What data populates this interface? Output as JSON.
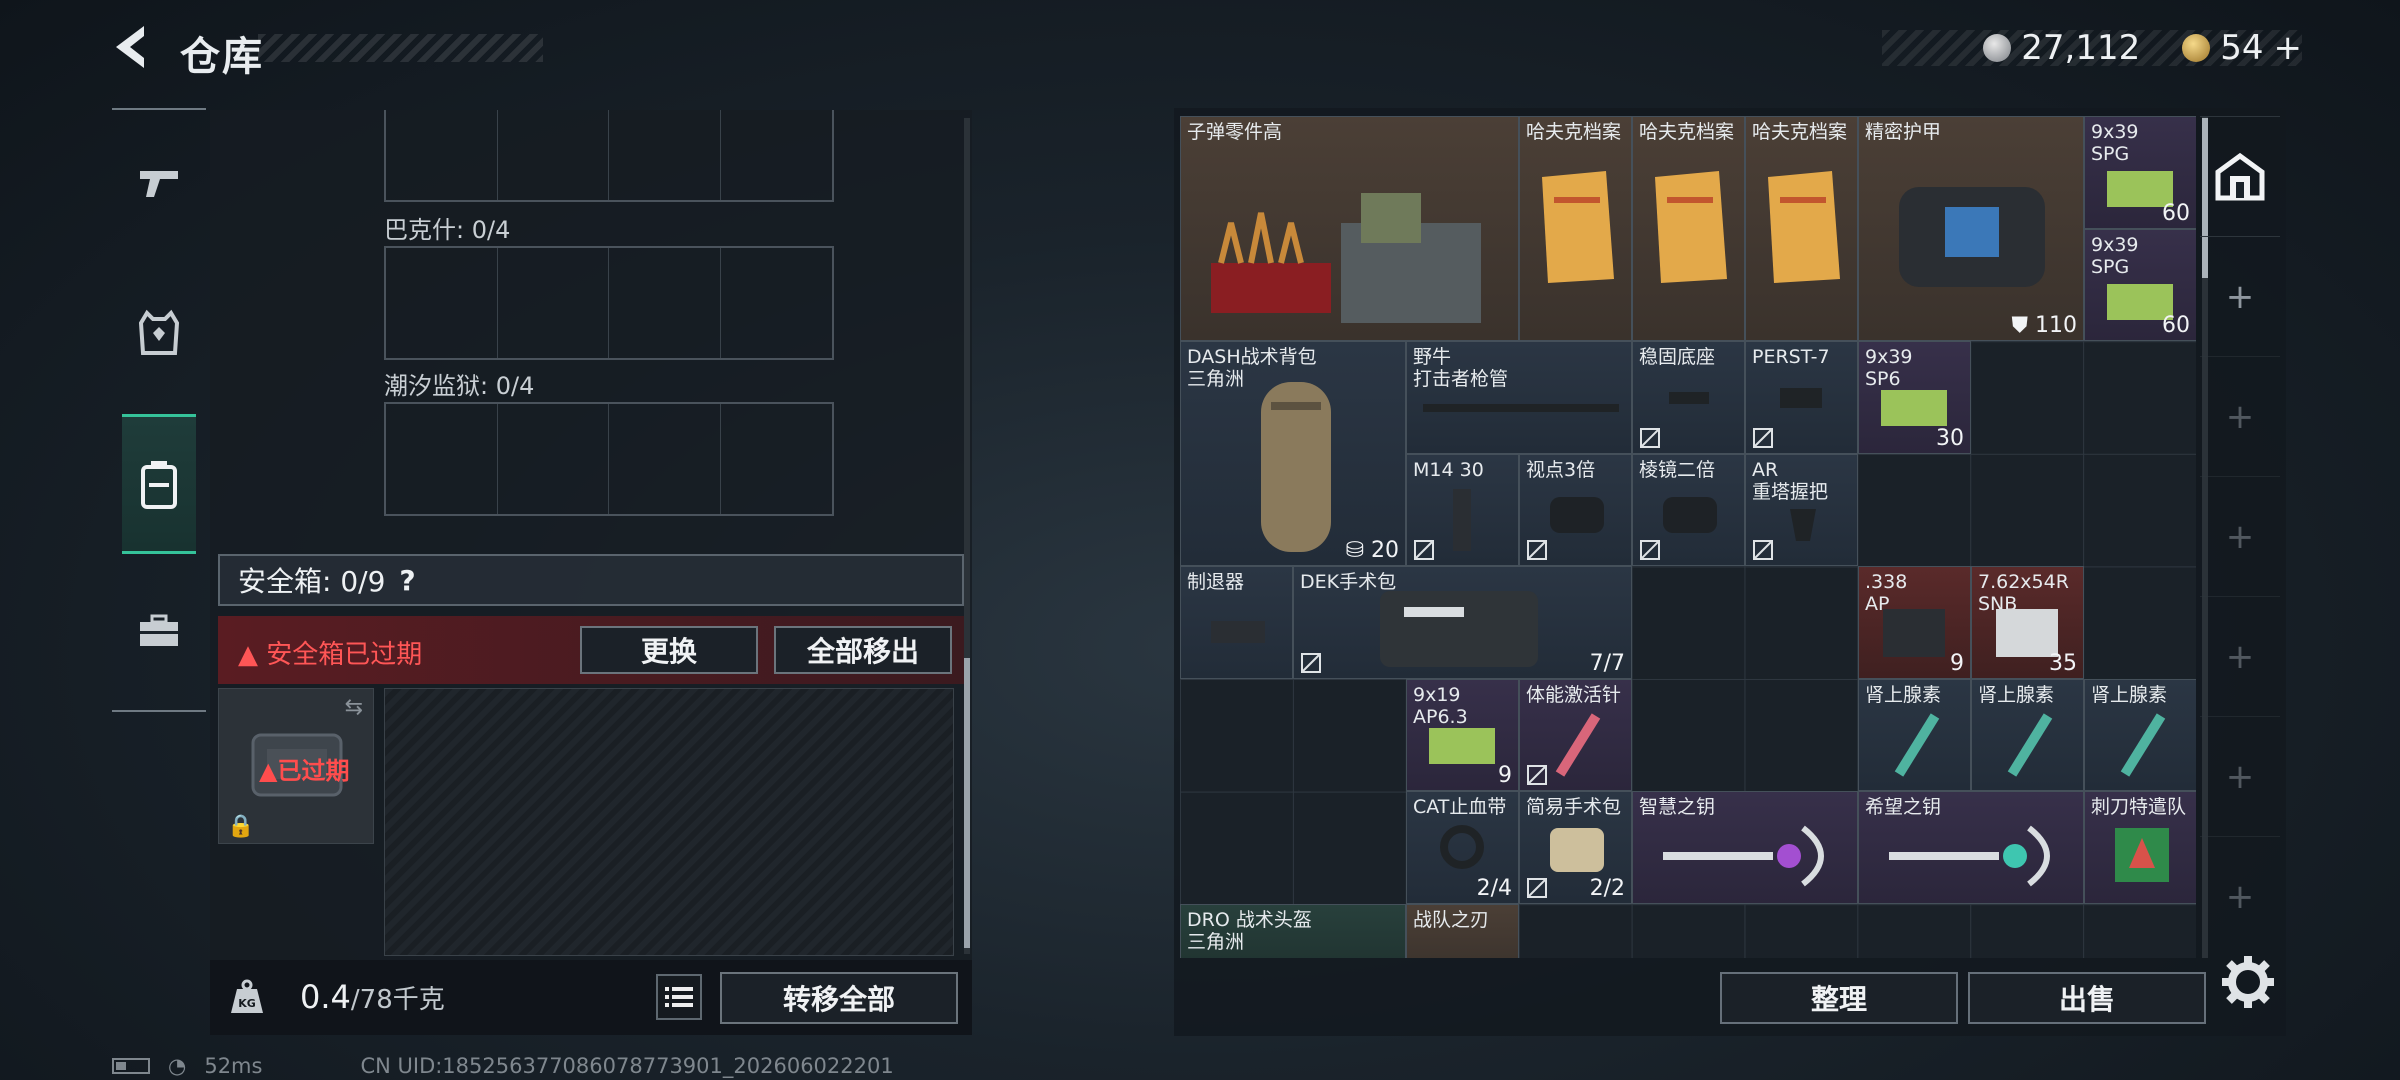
{
  "header": {
    "title": "仓库"
  },
  "currency": {
    "silver": "27,112",
    "gold": "54",
    "gold_plus": "+"
  },
  "left": {
    "labels": {
      "bakeshi": "巴克什: 0/4",
      "chaoxi": "潮汐监狱: 0/4"
    },
    "safe_box": {
      "label": "安全箱: 0/9",
      "help": "?",
      "expired_message": "安全箱已过期",
      "replace": "更换",
      "move_all_out": "全部移出",
      "expired_tag": "已过期"
    },
    "weight": {
      "value": "0.4",
      "capacity": "/78千克",
      "kg_label": "KG"
    },
    "transfer_all": "转移全部"
  },
  "inventory": {
    "items": [
      {
        "name": "子弹零件高",
        "count": ""
      },
      {
        "name": "哈夫克档案",
        "count": ""
      },
      {
        "name": "哈夫克档案",
        "count": ""
      },
      {
        "name": "哈夫克档案",
        "count": ""
      },
      {
        "name": "精密护甲",
        "count": "110"
      },
      {
        "name": "9x39\nSPG",
        "count": "60"
      },
      {
        "name": "9x39\nSPG",
        "count": "60"
      },
      {
        "name": "DASH战术背包\n三角洲",
        "count": "20"
      },
      {
        "name": "野牛\n打击者枪管",
        "count": ""
      },
      {
        "name": "稳固底座",
        "count": ""
      },
      {
        "name": "PERST-7",
        "count": ""
      },
      {
        "name": "9x39\nSP6",
        "count": "30"
      },
      {
        "name": "M14 30",
        "count": ""
      },
      {
        "name": "视点3倍",
        "count": ""
      },
      {
        "name": "棱镜二倍",
        "count": ""
      },
      {
        "name": "AR\n重塔握把",
        "count": ""
      },
      {
        "name": "制退器",
        "count": ""
      },
      {
        "name": "DEK手术包",
        "count": "7/7"
      },
      {
        "name": ".338\nAP",
        "count": "9"
      },
      {
        "name": "7.62x54R\nSNB",
        "count": "35"
      },
      {
        "name": "9x19\nAP6.3",
        "count": "9"
      },
      {
        "name": "体能激活针",
        "count": ""
      },
      {
        "name": "肾上腺素",
        "count": ""
      },
      {
        "name": "肾上腺素",
        "count": ""
      },
      {
        "name": "肾上腺素",
        "count": ""
      },
      {
        "name": "CAT止血带",
        "count": "2/4"
      },
      {
        "name": "简易手术包",
        "count": "2/2"
      },
      {
        "name": "智慧之钥",
        "count": ""
      },
      {
        "name": "希望之钥",
        "count": ""
      },
      {
        "name": "刺刀特遣队",
        "count": ""
      },
      {
        "name": "DRO 战术头盔\n三角洲",
        "count": ""
      },
      {
        "name": "战队之刃",
        "count": ""
      }
    ],
    "sort_button": "整理",
    "sell_button": "出售"
  },
  "right_tabs": {
    "plus": "+"
  },
  "status_bar": {
    "ping": "52ms",
    "uid": "CN UID:185256377086078773901_202606022201"
  },
  "colors": {
    "accent": "#35c39a",
    "danger": "#ff5656"
  }
}
